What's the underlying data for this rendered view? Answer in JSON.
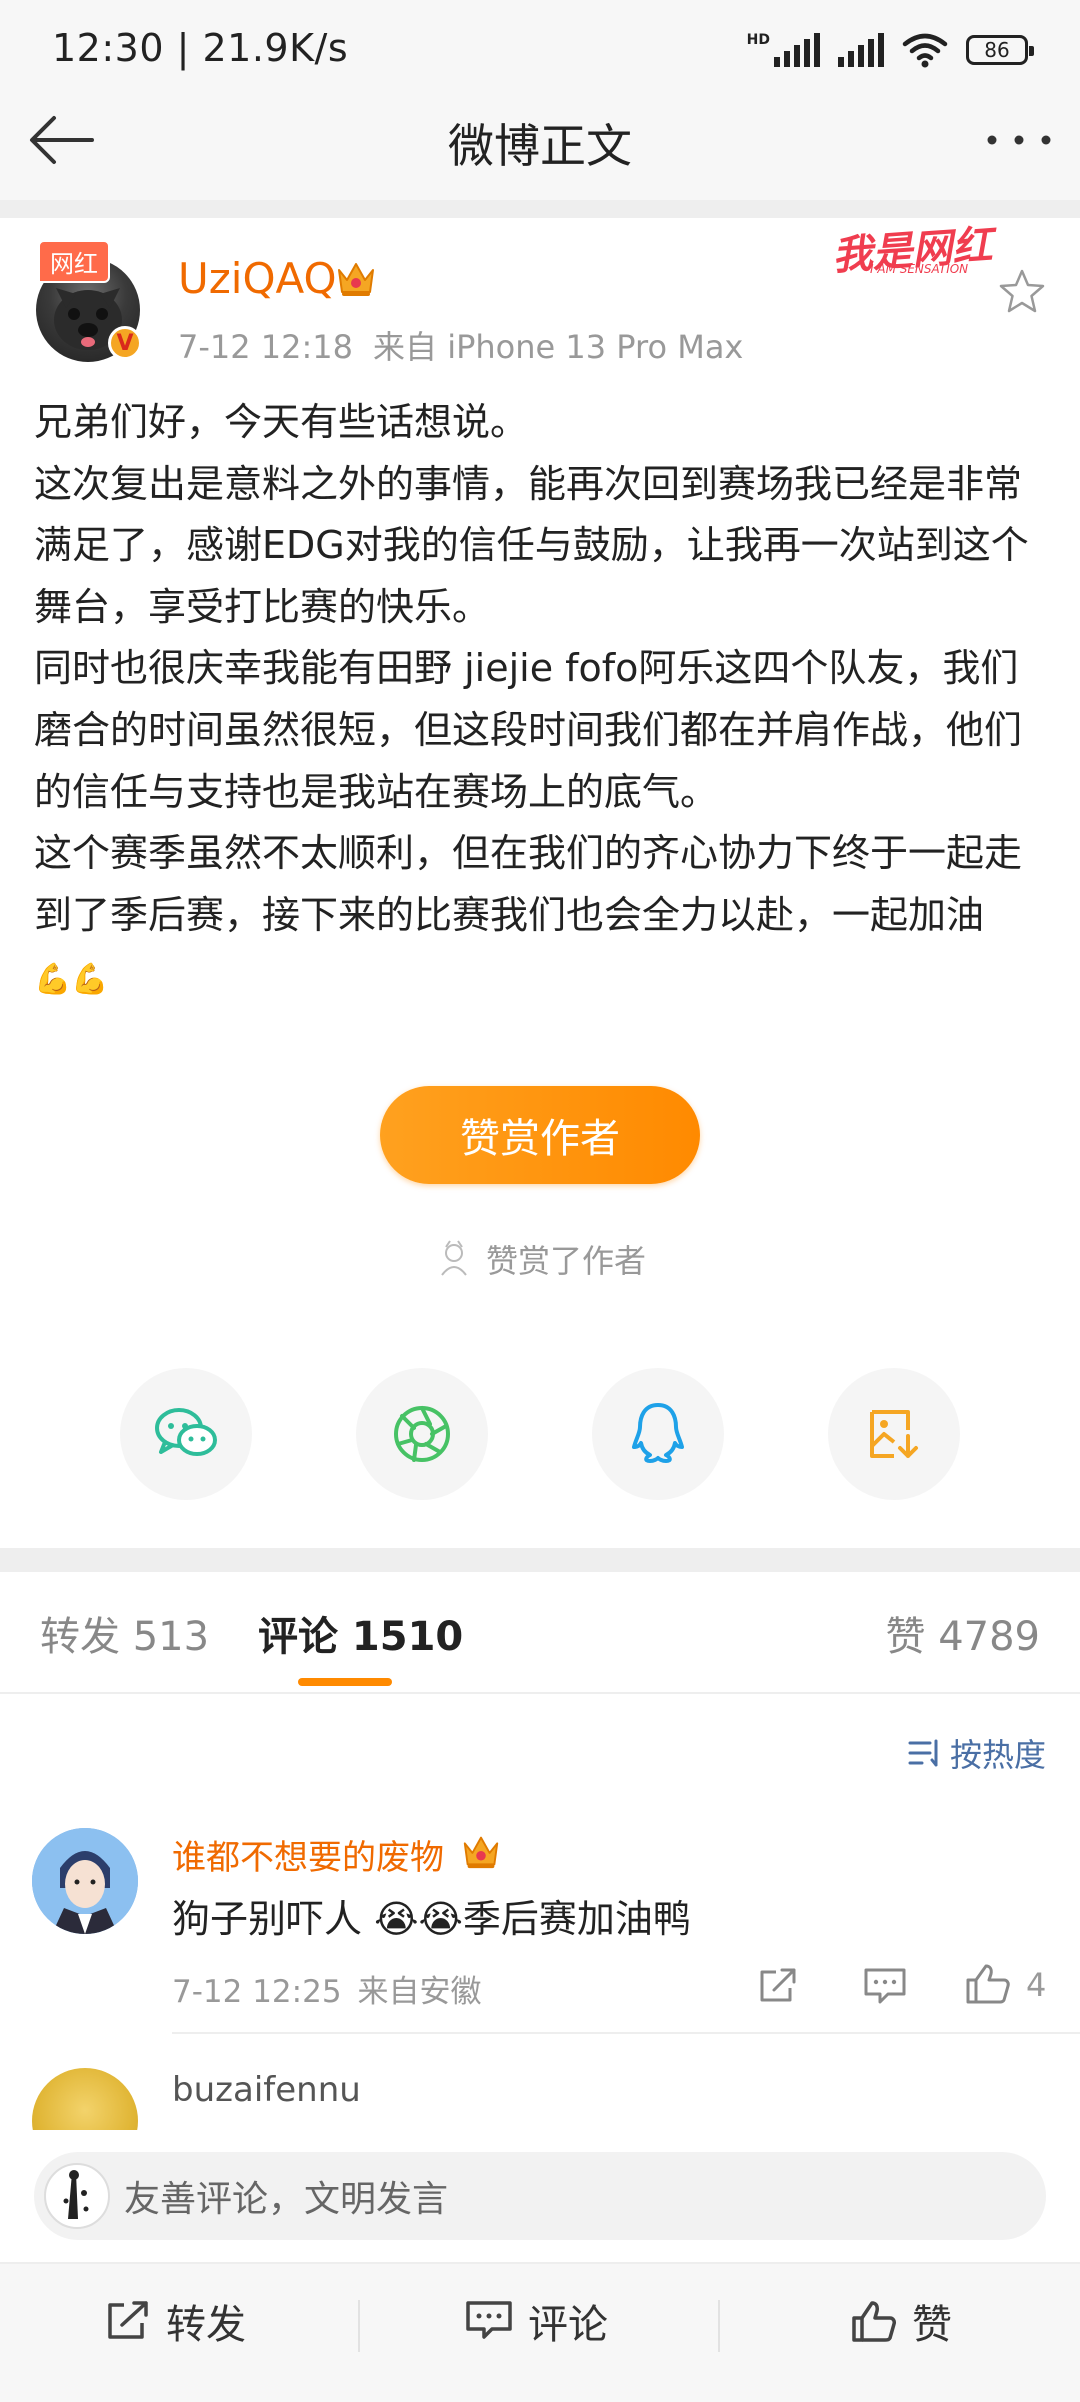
{
  "status_bar": {
    "time": "12:30",
    "speed": "21.9K/s",
    "battery": "86",
    "hd_label": "HD"
  },
  "nav": {
    "title": "微博正文"
  },
  "post": {
    "author": "UziQAQ",
    "badge": "网红",
    "verified_mark": "V",
    "time": "7-12 12:18",
    "source": "来自 iPhone 13 Pro Max",
    "stamp": "我是网红",
    "stamp_sub": "I AM SENSATION",
    "paragraphs": [
      "兄弟们好，今天有些话想说。",
      "这次复出是意料之外的事情，能再次回到赛场我已经是非常满足了，感谢EDG对我的信任与鼓励，让我再一次站到这个舞台，享受打比赛的快乐。",
      "同时也很庆幸我能有田野 jiejie fofo阿乐这四个队友，我们磨合的时间虽然很短，但这段时间我们都在并肩作战，他们的信任与支持也是我站在赛场上的底气。",
      "这个赛季虽然不太顺利，但在我们的齐心协力下终于一起走到了季后赛，接下来的比赛我们也会全力以赴，一起加油"
    ],
    "emoji": "💪💪",
    "tip_button": "赞赏作者",
    "tipped_text": "赞赏了作者"
  },
  "tabs": {
    "repost": "转发 513",
    "comment": "评论 1510",
    "like": "赞 4789"
  },
  "sort_label": "按热度",
  "comments": [
    {
      "name": "谁都不想要的废物",
      "text": "狗子别吓人 😭😭季后赛加油鸭",
      "time": "7-12 12:25",
      "source": "来自安徽",
      "likes": "4"
    },
    {
      "name": "buzaifennu"
    }
  ],
  "input": {
    "placeholder": "友善评论，文明发言"
  },
  "actions": {
    "repost": "转发",
    "comment": "评论",
    "like": "赞"
  },
  "colors": {
    "accent": "#ff8a00",
    "username": "#f06a00",
    "link": "#4a6fa5"
  }
}
